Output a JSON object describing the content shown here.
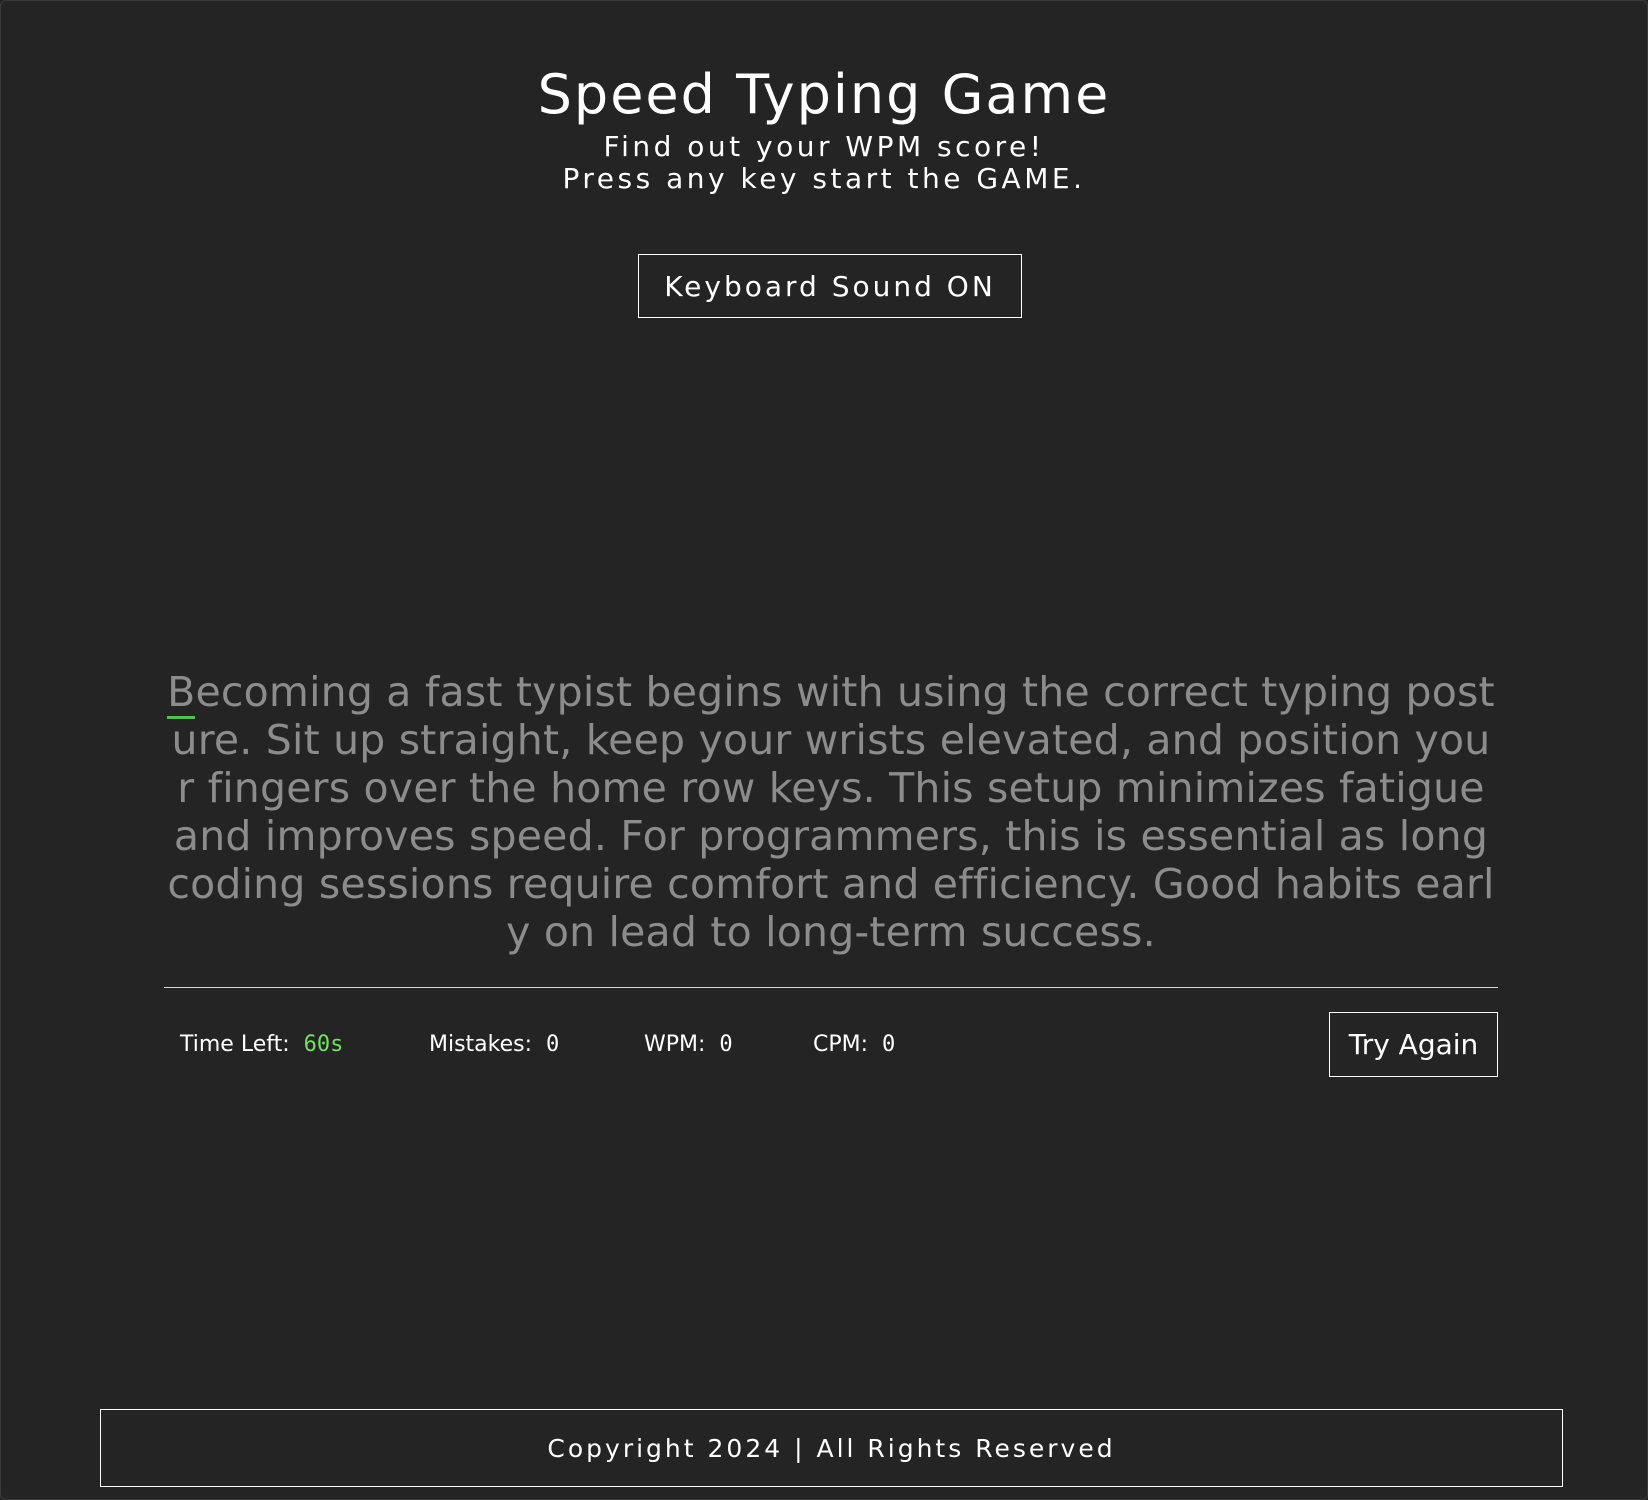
{
  "header": {
    "title": "Speed Typing Game",
    "subtitle_line1": "Find out your WPM score!",
    "subtitle_line2": "Press any key start the GAME."
  },
  "controls": {
    "sound_toggle_label": "Keyboard Sound ON",
    "try_again_label": "Try Again"
  },
  "paragraph": {
    "first_char": "B",
    "rest": "ecoming a fast typist begins with using the correct typing posture. Sit up straight, keep your wrists elevated, and position your fingers over the home row keys. This setup minimizes fatigue and improves speed. For programmers, this is essential as long coding sessions require comfort and efficiency. Good habits early on lead to long-term success."
  },
  "stats": {
    "time_label": "Time Left:",
    "time_value": "60s",
    "mistakes_label": "Mistakes:",
    "mistakes_value": "0",
    "wpm_label": "WPM:",
    "wpm_value": "0",
    "cpm_label": "CPM:",
    "cpm_value": "0"
  },
  "footer": {
    "text": "Copyright 2024 | All Rights Reserved"
  },
  "colors": {
    "background": "#242424",
    "text": "#ffffff",
    "untyped_text": "#8c8c8c",
    "accent_green": "#6fe35a",
    "cursor_underline": "#4ec24e"
  }
}
